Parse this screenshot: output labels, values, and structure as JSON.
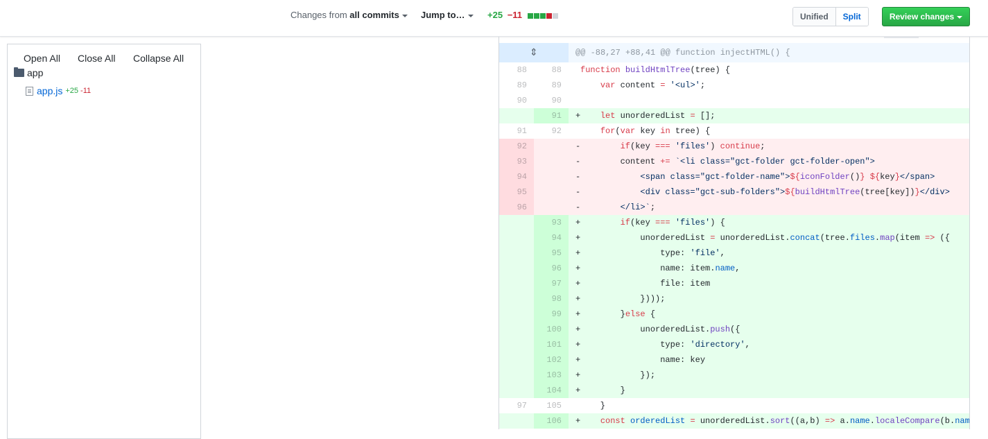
{
  "toolbar": {
    "changes_prefix": "Changes from",
    "changes_value": "all commits",
    "jump_label": "Jump to…",
    "additions": "+25",
    "deletions": "−11",
    "diffstat_colors": [
      "#28a745",
      "#28a745",
      "#28a745",
      "#cb2431",
      "#d1d5da"
    ],
    "view_unified": "Unified",
    "view_split": "Split",
    "active_view": "Split",
    "review_label": "Review changes"
  },
  "tree": {
    "open_all": "Open All",
    "close_all": "Close All",
    "collapse_all": "Collapse All",
    "folder": "app",
    "file": {
      "name": "app.js",
      "additions": "+25",
      "deletions": "-11"
    }
  },
  "diff": {
    "hunk_header": "@@ -88,27 +88,41 @@ function injectHTML() {",
    "lines": [
      {
        "type": "ctx",
        "old": "88",
        "new": "88",
        "marker": " ",
        "html": "<span class=\"k\">function</span> <span class=\"f\">buildHtmlTree</span>(tree) {"
      },
      {
        "type": "ctx",
        "old": "89",
        "new": "89",
        "marker": " ",
        "html": "    <span class=\"k\">var</span> content <span class=\"k\">=</span> <span class=\"s\">'&lt;ul&gt;'</span>;"
      },
      {
        "type": "ctx",
        "old": "90",
        "new": "90",
        "marker": " ",
        "html": ""
      },
      {
        "type": "add",
        "old": "",
        "new": "91",
        "marker": "+",
        "html": "    <span class=\"k\">let</span> unorderedList <span class=\"k\">=</span> [];"
      },
      {
        "type": "ctx",
        "old": "91",
        "new": "92",
        "marker": " ",
        "html": "    <span class=\"k\">for</span>(<span class=\"k\">var</span> key <span class=\"k\">in</span> tree) {"
      },
      {
        "type": "del",
        "old": "92",
        "new": "",
        "marker": "-",
        "html": "        <span class=\"k\">if</span>(key <span class=\"k\">===</span> <span class=\"s\">'files'</span>) <span class=\"k\">continue</span>;"
      },
      {
        "type": "del",
        "old": "93",
        "new": "",
        "marker": "-",
        "html": "        content <span class=\"k\">+=</span> <span class=\"s\">`&lt;li class=\"gct-folder gct-folder-open\"&gt;</span>"
      },
      {
        "type": "del",
        "old": "94",
        "new": "",
        "marker": "-",
        "html": "<span class=\"s\">            &lt;span class=\"gct-folder-name\"&gt;</span><span class=\"k\">${</span><span class=\"f\">iconFolder</span>()<span class=\"k\">}</span> <span class=\"k\">${</span>key<span class=\"k\">}</span><span class=\"s\">&lt;/span&gt;</span>"
      },
      {
        "type": "del",
        "old": "95",
        "new": "",
        "marker": "-",
        "html": "<span class=\"s\">            &lt;div class=\"gct-sub-folders\"&gt;</span><span class=\"k\">${</span><span class=\"f\">buildHtmlTree</span>(tree[key])<span class=\"k\">}</span><span class=\"s\">&lt;/div&gt;</span>"
      },
      {
        "type": "del",
        "old": "96",
        "new": "",
        "marker": "-",
        "html": "<span class=\"s\">        &lt;/li&gt;`</span>;"
      },
      {
        "type": "add",
        "old": "",
        "new": "93",
        "marker": "+",
        "html": "        <span class=\"k\">if</span>(key <span class=\"k\">===</span> <span class=\"s\">'files'</span>) {"
      },
      {
        "type": "add",
        "old": "",
        "new": "94",
        "marker": "+",
        "html": "            unorderedList <span class=\"k\">=</span> unorderedList.<span class=\"p\">concat</span>(tree.<span class=\"p\">files</span>.<span class=\"f\">map</span>(item <span class=\"k\">=&gt;</span> ({"
      },
      {
        "type": "add",
        "old": "",
        "new": "95",
        "marker": "+",
        "html": "                type: <span class=\"s\">'file'</span>,"
      },
      {
        "type": "add",
        "old": "",
        "new": "96",
        "marker": "+",
        "html": "                name: item.<span class=\"p\">name</span>,"
      },
      {
        "type": "add",
        "old": "",
        "new": "97",
        "marker": "+",
        "html": "                file: item"
      },
      {
        "type": "add",
        "old": "",
        "new": "98",
        "marker": "+",
        "html": "            })));"
      },
      {
        "type": "add",
        "old": "",
        "new": "99",
        "marker": "+",
        "html": "        }<span class=\"k\">else</span> {"
      },
      {
        "type": "add",
        "old": "",
        "new": "100",
        "marker": "+",
        "html": "            unorderedList.<span class=\"f\">push</span>({"
      },
      {
        "type": "add",
        "old": "",
        "new": "101",
        "marker": "+",
        "html": "                type: <span class=\"s\">'directory'</span>,"
      },
      {
        "type": "add",
        "old": "",
        "new": "102",
        "marker": "+",
        "html": "                name: key"
      },
      {
        "type": "add",
        "old": "",
        "new": "103",
        "marker": "+",
        "html": "            });"
      },
      {
        "type": "add",
        "old": "",
        "new": "104",
        "marker": "+",
        "html": "        }"
      },
      {
        "type": "ctx",
        "old": "97",
        "new": "105",
        "marker": " ",
        "html": "    }"
      },
      {
        "type": "add",
        "old": "",
        "new": "106",
        "marker": "+",
        "html": "    <span class=\"k\">const</span> <span class=\"p\">orderedList</span> <span class=\"k\">=</span> unorderedList.<span class=\"f\">sort</span>((a,b) <span class=\"k\">=&gt;</span> a.<span class=\"p\">name</span>.<span class=\"f\">localeCompare</span>(b.<span class=\"p\">name</span>"
      }
    ]
  }
}
